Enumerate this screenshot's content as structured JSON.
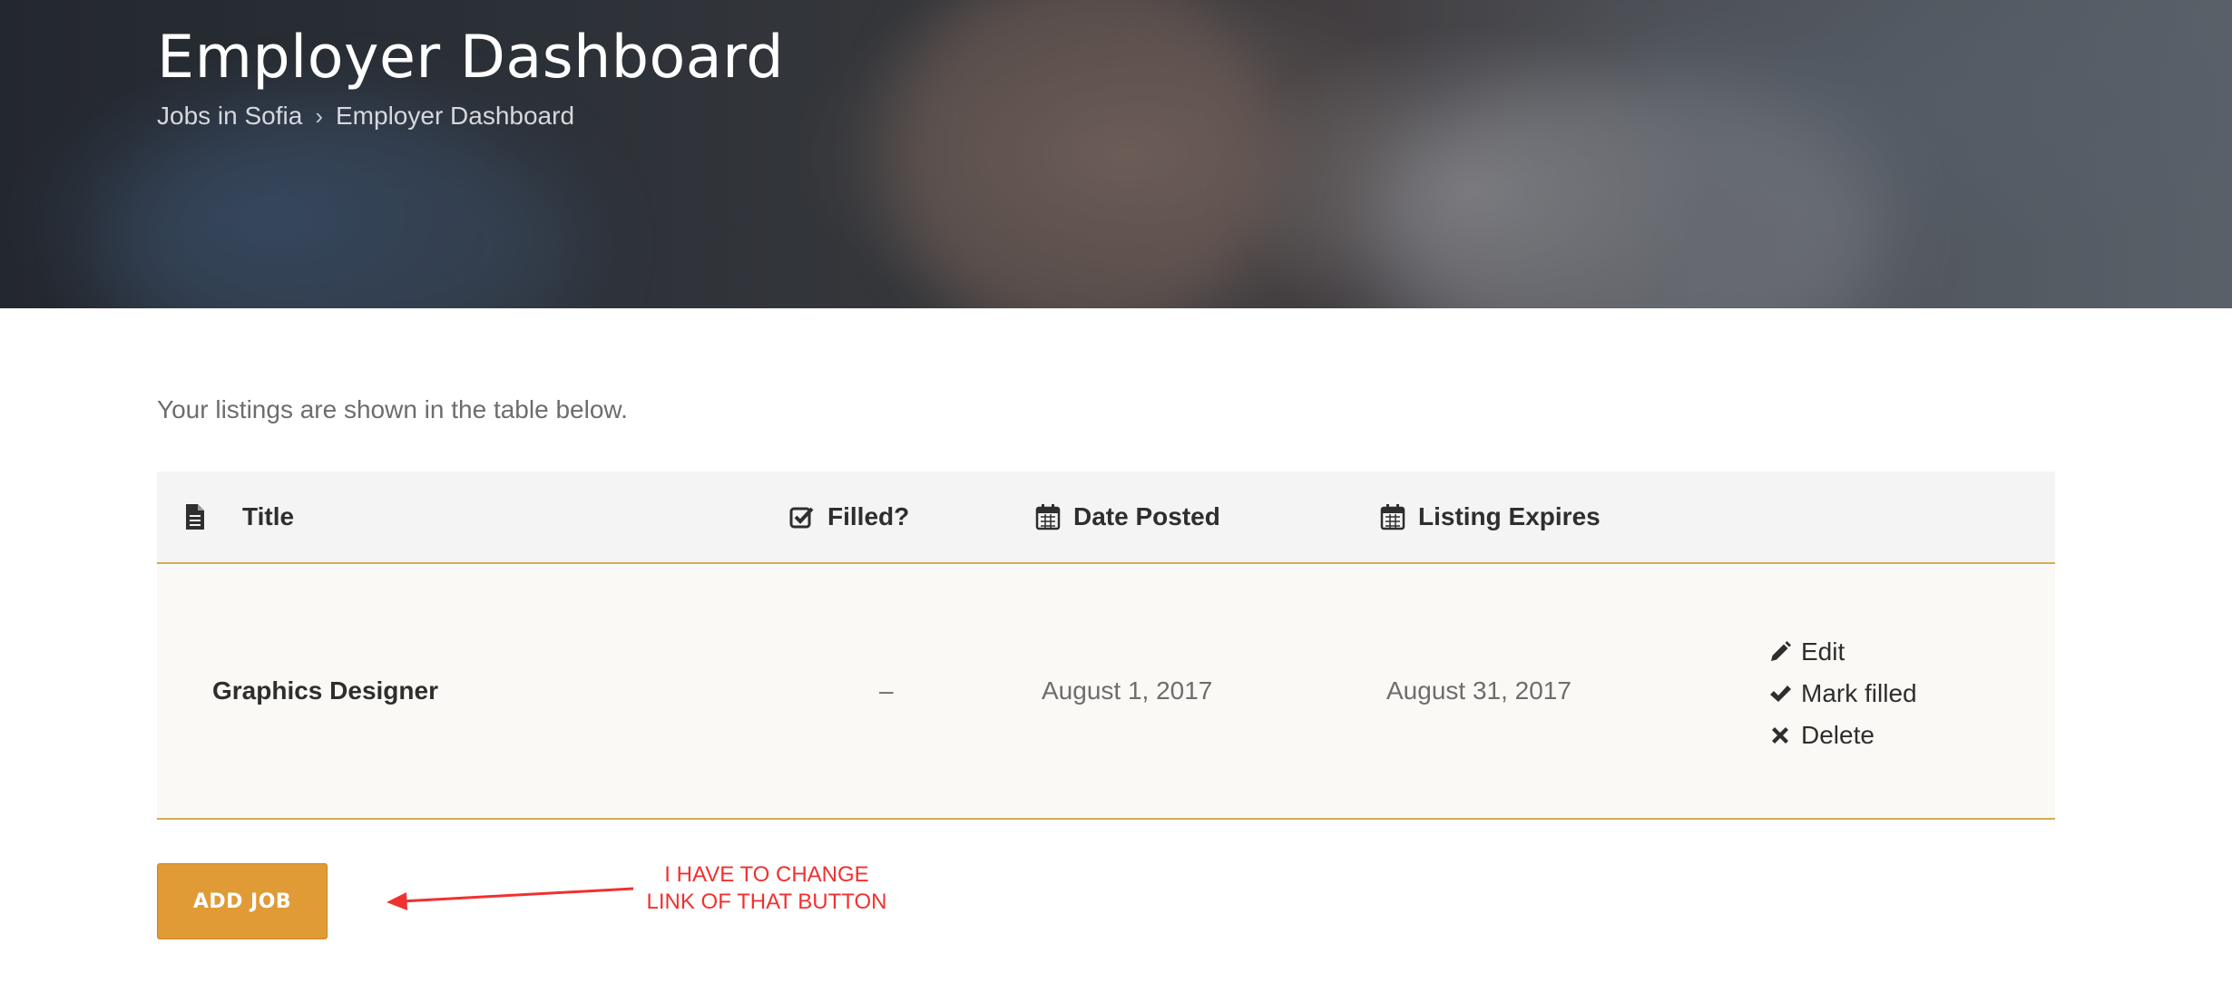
{
  "hero": {
    "title": "Employer Dashboard",
    "breadcrumb": [
      {
        "label": "Jobs in Sofia"
      },
      {
        "label": "Employer Dashboard"
      }
    ],
    "separator": "›"
  },
  "intro_text": "Your listings are shown in the table below.",
  "table": {
    "columns": [
      {
        "label": "Title",
        "icon": "document-icon"
      },
      {
        "label": "Filled?",
        "icon": "checkbox-icon"
      },
      {
        "label": "Date Posted",
        "icon": "calendar-icon"
      },
      {
        "label": "Listing Expires",
        "icon": "calendar-icon"
      }
    ],
    "rows": [
      {
        "title": "Graphics Designer",
        "filled": "–",
        "date_posted": "August 1, 2017",
        "listing_expires": "August 31, 2017",
        "actions": [
          {
            "label": "Edit",
            "icon": "pencil-icon"
          },
          {
            "label": "Mark filled",
            "icon": "check-icon"
          },
          {
            "label": "Delete",
            "icon": "x-icon"
          }
        ]
      }
    ]
  },
  "add_button": {
    "label": "ADD JOB"
  },
  "annotation": {
    "line1": "I HAVE TO CHANGE",
    "line2": "LINK OF THAT BUTTON"
  },
  "colors": {
    "accent": "#e09b37",
    "row_border": "#d6ab57",
    "annotation": "#f0312f"
  }
}
